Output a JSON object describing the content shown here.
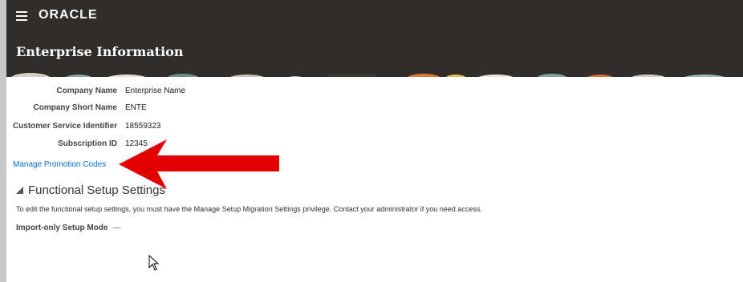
{
  "header": {
    "brand": "ORACLE",
    "menu_icon": "hamburger-icon"
  },
  "page": {
    "title": "Enterprise Information"
  },
  "fields": [
    {
      "label": "Company Name",
      "value": "Enterprise Name"
    },
    {
      "label": "Company Short Name",
      "value": "ENTE"
    },
    {
      "label": "Customer Service Identifier",
      "value": "18559323"
    },
    {
      "label": "Subscription ID",
      "value": "12345"
    }
  ],
  "links": {
    "manage_promo": "Manage Promotion Codes"
  },
  "functional_setup": {
    "title": "Functional Setup Settings",
    "info": "To edit the functional setup settings, you must have the Manage Setup Migration Settings privilege. Contact your administrator if you need access.",
    "import_label": "Import-only Setup Mode",
    "import_value": "—"
  },
  "colors": {
    "header_bg": "#312d2a",
    "link": "#0572ce",
    "arrow": "#e30000"
  }
}
